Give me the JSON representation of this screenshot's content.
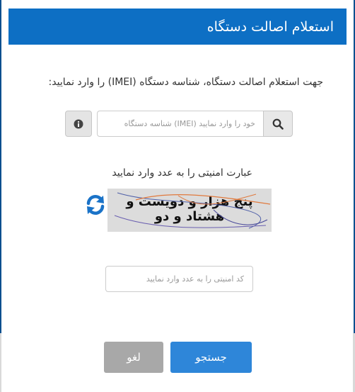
{
  "modal": {
    "title": "استعلام اصالت دستگاه",
    "instruction": "جهت استعلام اصالت دستگاه، شناسه دستگاه (IMEI) را وارد نمایید:",
    "imei_placeholder": "خود را وارد نمایید (IMEI) شناسه دستگاه",
    "captcha_label": "عبارت امنیتی را به عدد وارد نمایید",
    "captcha_text_line1": "پنج هزار و دویست و",
    "captcha_text_line2": "هشتاد و دو",
    "code_placeholder": "کد امنیتی را به عدد وارد نمایید",
    "search_button": "جستجو",
    "cancel_button": "لغو"
  },
  "icons": {
    "info": "info-icon",
    "search": "search-icon",
    "refresh": "refresh-icon"
  },
  "colors": {
    "header": "#0d6fc4",
    "primary_button": "#2e86d9",
    "cancel_button": "#a8a8a8",
    "refresh_icon": "#1a73c8"
  }
}
